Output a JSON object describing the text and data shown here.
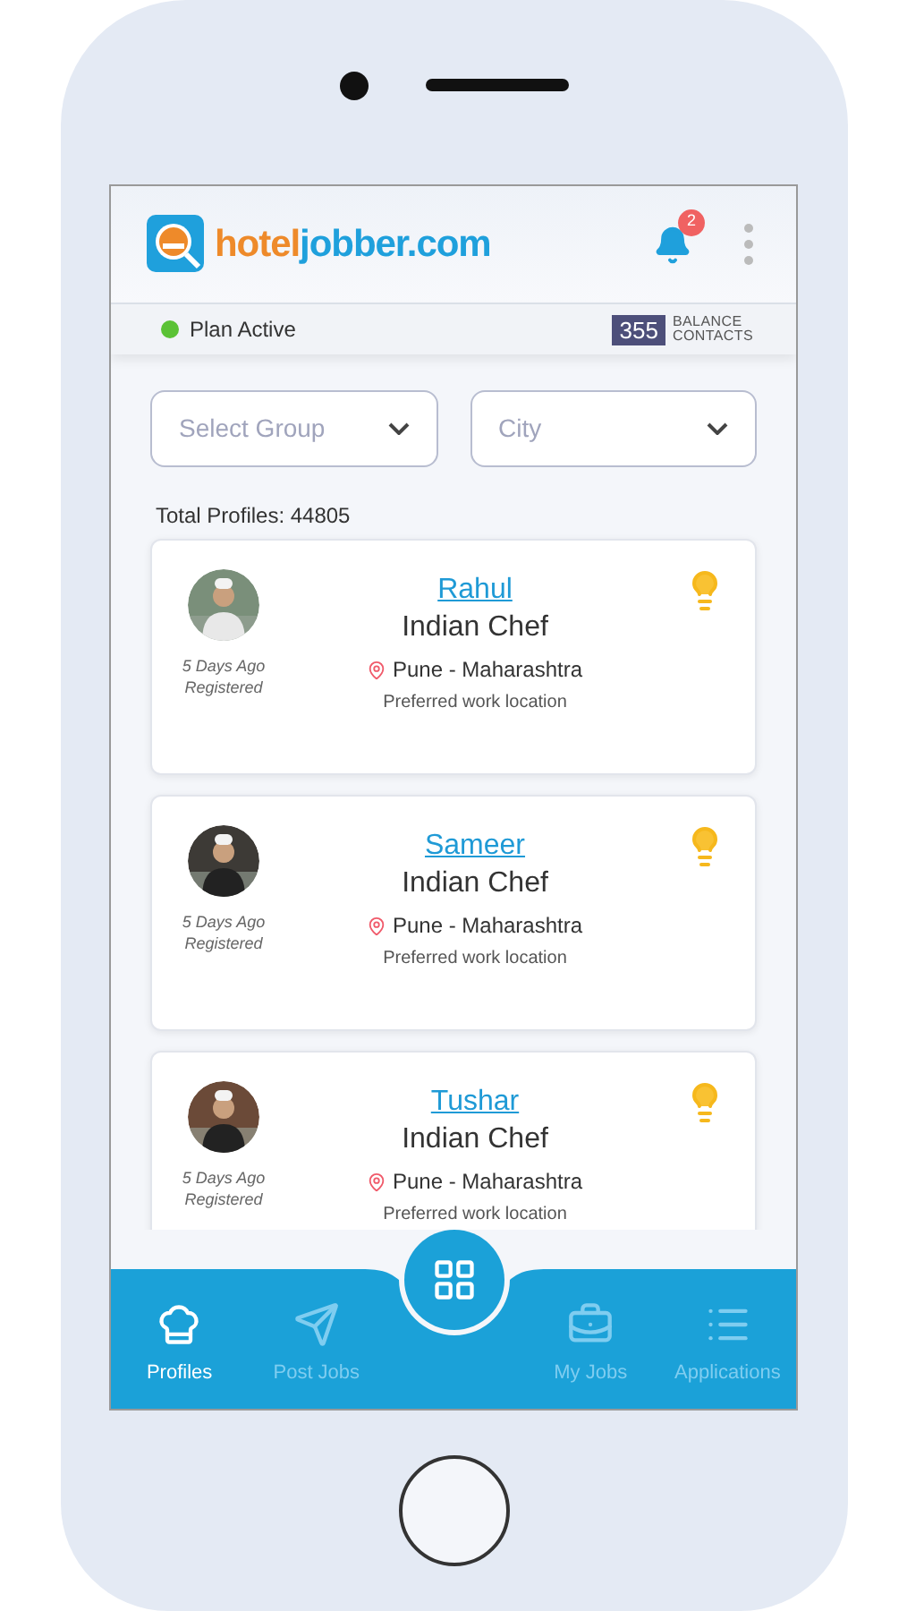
{
  "header": {
    "logo_part_1": "hotel",
    "logo_part_2": "jobber.com",
    "notification_count": "2"
  },
  "plan_bar": {
    "status": "Plan Active",
    "active": true,
    "balance": "355",
    "balance_label_1": "BALANCE",
    "balance_label_2": "CONTACTS"
  },
  "filters": [
    {
      "placeholder": "Select Group"
    },
    {
      "placeholder": "City"
    }
  ],
  "total_profiles": "Total Profiles: 44805",
  "profiles": [
    {
      "name": "Rahul",
      "title": "Indian Chef",
      "registered_1": "5 Days Ago",
      "registered_2": "Registered",
      "location": "Pune - Maharashtra",
      "location_note": "Preferred work location"
    },
    {
      "name": "Sameer",
      "title": "Indian Chef",
      "registered_1": "5 Days Ago",
      "registered_2": "Registered",
      "location": "Pune - Maharashtra",
      "location_note": "Preferred work location"
    },
    {
      "name": "Tushar",
      "title": "Indian Chef",
      "registered_1": "5 Days Ago",
      "registered_2": "Registered",
      "location": "Pune - Maharashtra",
      "location_note": "Preferred work location"
    }
  ],
  "bottom_nav": [
    {
      "kind": "chef",
      "label": "Profiles",
      "selected": true
    },
    {
      "kind": "send",
      "label": "Post Jobs",
      "selected": false
    },
    {
      "kind": "bag",
      "label": "My Jobs",
      "selected": false
    },
    {
      "kind": "list",
      "label": "Applications",
      "selected": false
    }
  ]
}
